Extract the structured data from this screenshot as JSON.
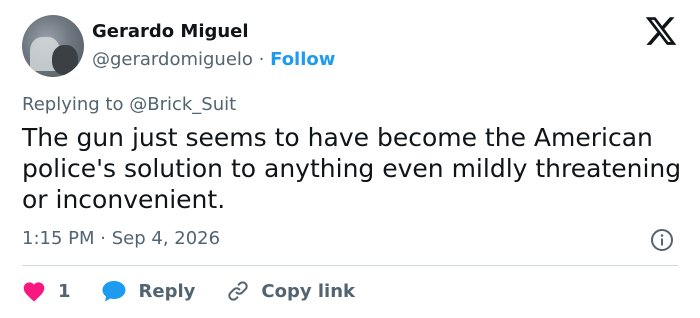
{
  "author": {
    "name": "Gerardo Miguel",
    "handle": "@gerardomiguelo",
    "separator": "·",
    "follow_label": "Follow"
  },
  "reply_context": {
    "prefix": "Replying to",
    "mention": "@Brick_Suit"
  },
  "tweet": {
    "text": "The gun just seems to have become the American police's solution to anything even mildly threatening or inconvenient."
  },
  "meta": {
    "time": "1:15 PM",
    "separator": "·",
    "date": "Sep 4, 2026"
  },
  "actions": {
    "like_count": "1",
    "reply_label": "Reply",
    "copy_link_label": "Copy link"
  },
  "icons": {
    "logo": "x-logo-icon",
    "info": "info-icon",
    "like": "heart-icon",
    "reply": "speech-bubble-icon",
    "copy": "link-icon"
  },
  "colors": {
    "text": "#0f1419",
    "secondary": "#536471",
    "follow": "#1d9bf0",
    "heart": "#f91880",
    "reply_bubble": "#1d9bf0",
    "divider": "#cfd9de"
  }
}
